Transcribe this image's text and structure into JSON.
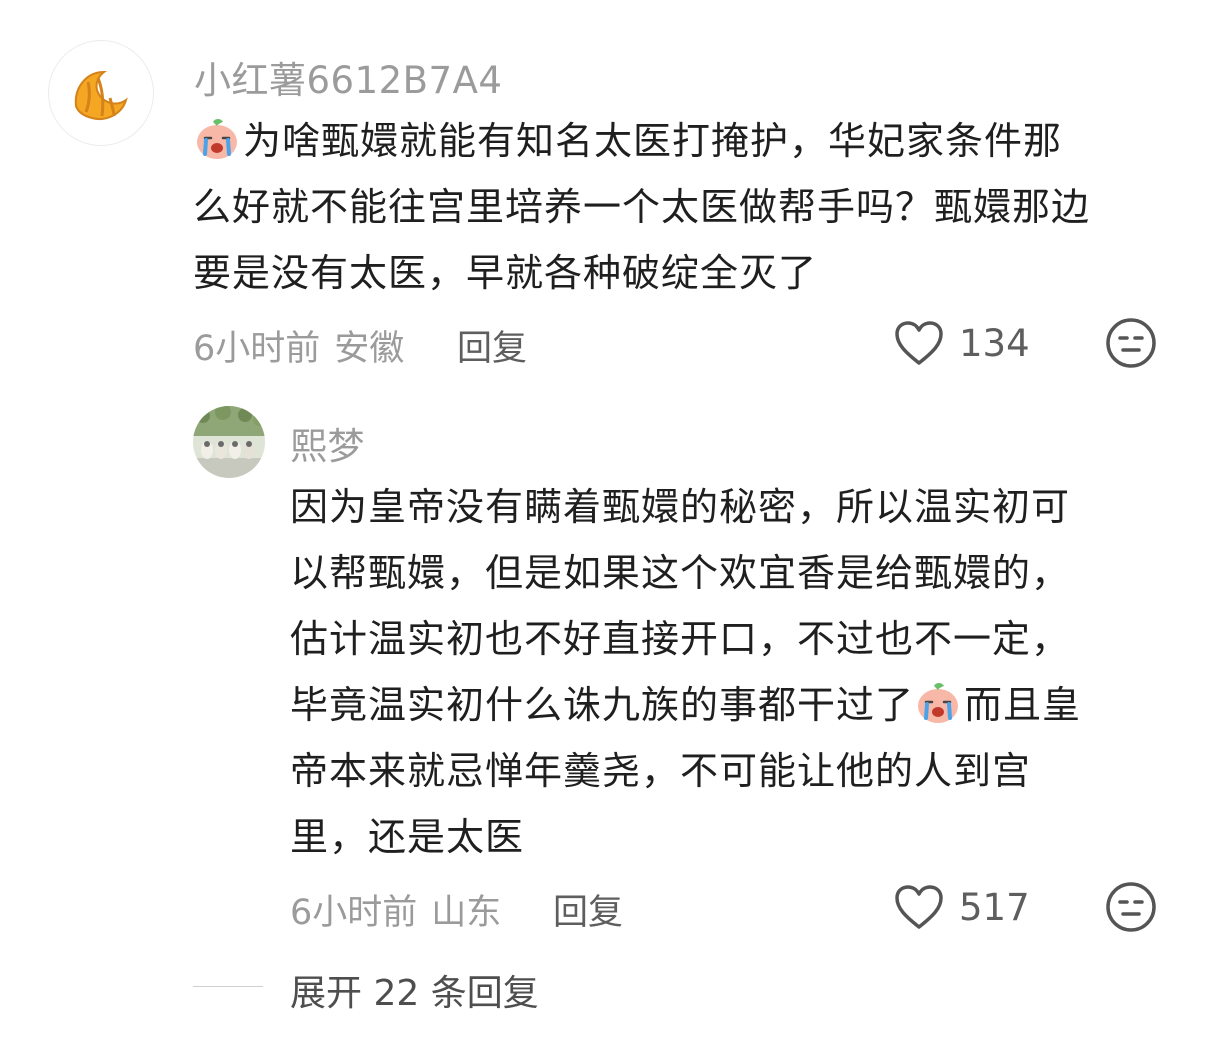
{
  "comment": {
    "username": "小红薯6612B7A4",
    "avatar_icon": "croissant-icon",
    "lines": [
      "为啥甄嬛就能有知名太医打掩护，华妃家条件那",
      "么好就不能往宫里培养一个太医做帮手吗？甄嬛那边",
      "要是没有太医，早就各种破绽全灭了"
    ],
    "emoji_icon": "crying-peach-emoji-icon",
    "time": "6小时前",
    "location": "安徽",
    "reply_label": "回复",
    "likes": "134"
  },
  "reply": {
    "username": "熙梦",
    "avatar_icon": "cats-photo-avatar",
    "lines_before_emoji": [
      "因为皇帝没有瞒着甄嬛的秘密，所以温实初可",
      "以帮甄嬛，但是如果这个欢宜香是给甄嬛的，",
      "估计温实初也不好直接开口，不过也不一定，"
    ],
    "line4_a": "毕竟温实初什么诛九族的事都干过了",
    "line4_b": "而且皇",
    "lines_after_emoji": [
      "帝本来就忌惮年羹尧，不可能让他的人到宫",
      "里，还是太医"
    ],
    "emoji_icon": "crying-peach-emoji-icon",
    "time": "6小时前",
    "location": "山东",
    "reply_label": "回复",
    "likes": "517"
  },
  "expand_replies": "展开 22 条回复",
  "colors": {
    "text": "#1f1f1f",
    "muted": "#9b9b9b",
    "icon": "#555555"
  }
}
